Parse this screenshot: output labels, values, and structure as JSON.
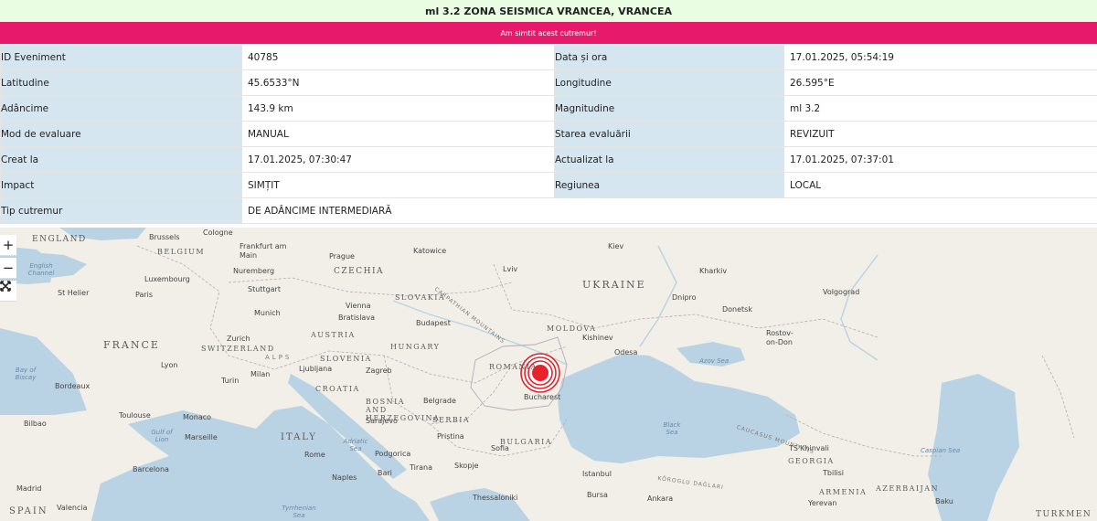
{
  "header": {
    "title": "ml 3.2 ZONA SEISMICA VRANCEA, VRANCEA"
  },
  "felt_button": {
    "label": "Am simtit acest cutremur!"
  },
  "details": {
    "rows": [
      {
        "l1": "ID Eveniment",
        "v1": "40785",
        "l2": "Data și ora",
        "v2": "17.01.2025, 05:54:19"
      },
      {
        "l1": "Latitudine",
        "v1": "45.6533°N",
        "l2": "Longitudine",
        "v2": "26.595°E"
      },
      {
        "l1": "Adâncime",
        "v1": "143.9 km",
        "l2": "Magnitudine",
        "v2": "ml 3.2"
      },
      {
        "l1": "Mod de evaluare",
        "v1": "MANUAL",
        "l2": "Starea evaluării",
        "v2": "REVIZUIT"
      },
      {
        "l1": "Creat la",
        "v1": "17.01.2025, 07:30:47",
        "l2": "Actualizat la",
        "v2": "17.01.2025, 07:37:01"
      },
      {
        "l1": "Impact",
        "v1": "SIMȚIT",
        "l2": "Regiunea",
        "v2": "LOCAL"
      },
      {
        "l1": "Tip cutremur",
        "v1": "DE ADÂNCIME INTERMEDIARĂ"
      }
    ]
  },
  "map": {
    "controls": {
      "zoom_in": "+",
      "zoom_out": "−",
      "fullscreen_icon": "fullscreen-icon"
    },
    "countries": [
      "ENGLAND",
      "BELGIUM",
      "FRANCE",
      "SWITZERLAND",
      "AUSTRIA",
      "SLOVENIA",
      "CROATIA",
      "BOSNIA AND HERZEGOVINA",
      "ITALY",
      "SPAIN",
      "CZECHIA",
      "SLOVAKIA",
      "HUNGARY",
      "SERBIA",
      "BULGARIA",
      "ROMANIA",
      "MOLDOVA",
      "UKRAINE",
      "GEORGIA",
      "ARMENIA",
      "AZERBAIJAN",
      "TURKMEN"
    ],
    "cities": [
      "Brussels",
      "Cologne",
      "Frankfurt am Main",
      "Prague",
      "Katowice",
      "Kiev",
      "Luxembourg",
      "Nuremberg",
      "Lviv",
      "Kharkiv",
      "St Helier",
      "Paris",
      "Stuttgart",
      "Dnipro",
      "Volgograd",
      "Munich",
      "Vienna",
      "Bratislava",
      "Budapest",
      "Donetsk",
      "Zurich",
      "Kishinev",
      "Rostov-on-Don",
      "Odesa",
      "Lyon",
      "Ljubljana",
      "Milan",
      "Turin",
      "Zagreb",
      "Bordeaux",
      "Belgrade",
      "Bucharest",
      "Toulouse",
      "Monaco",
      "Marseille",
      "Sarajevo",
      "Bilbao",
      "Pristina",
      "Sofia",
      "Podgorica",
      "Barcelona",
      "Rome",
      "Tirana",
      "Skopje",
      "Naples",
      "Bari",
      "Istanbul",
      "Madrid",
      "Valencia",
      "Thessaloniki",
      "Bursa",
      "Ankara",
      "TS'Khinvali",
      "Tbilisi",
      "Yerevan",
      "Baku",
      "Dnipro"
    ],
    "seas": [
      "English Channel",
      "Bay of Biscay",
      "Gulf of Lion",
      "Adriatic Sea",
      "Tyrrhenian Sea",
      "Black Sea",
      "Azov Sea",
      "Caspian Sea"
    ],
    "ranges": [
      "CARPATHIAN MOUNTAINS",
      "CAUCASUS MOUNTAINS",
      "KÖROGLU DAĞLARI",
      "ALPS"
    ],
    "colors": {
      "land": "#f1efe7",
      "water": "#b9d3e4",
      "epicenter": "#e8212a"
    }
  }
}
